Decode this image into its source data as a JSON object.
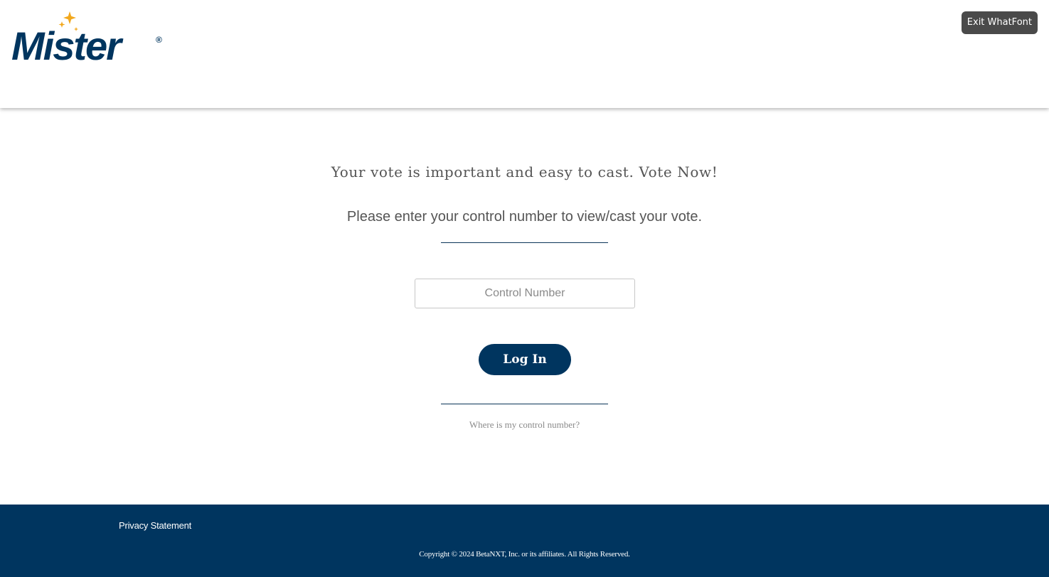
{
  "header": {
    "logo_text": "Mister",
    "logo_registered": "®",
    "exit_button_label": "Exit WhatFont"
  },
  "main": {
    "headline": "Your vote is important and easy to cast. Vote Now!",
    "instruction": "Please enter your control number to view/cast your vote.",
    "control_input": {
      "value": "",
      "placeholder": "Control Number"
    },
    "login_button_label": "Log In",
    "help_link": "Where is my control number?"
  },
  "footer": {
    "privacy_link": "Privacy Statement",
    "copyright": "Copyright © 2024 BetaNXT, Inc. or its affiliates. All Rights Reserved."
  },
  "colors": {
    "brand_navy": "#00355f",
    "star_gold": "#f2a81d",
    "text_gray": "#555555"
  },
  "icons": [
    "sparkle-stars-icon"
  ]
}
